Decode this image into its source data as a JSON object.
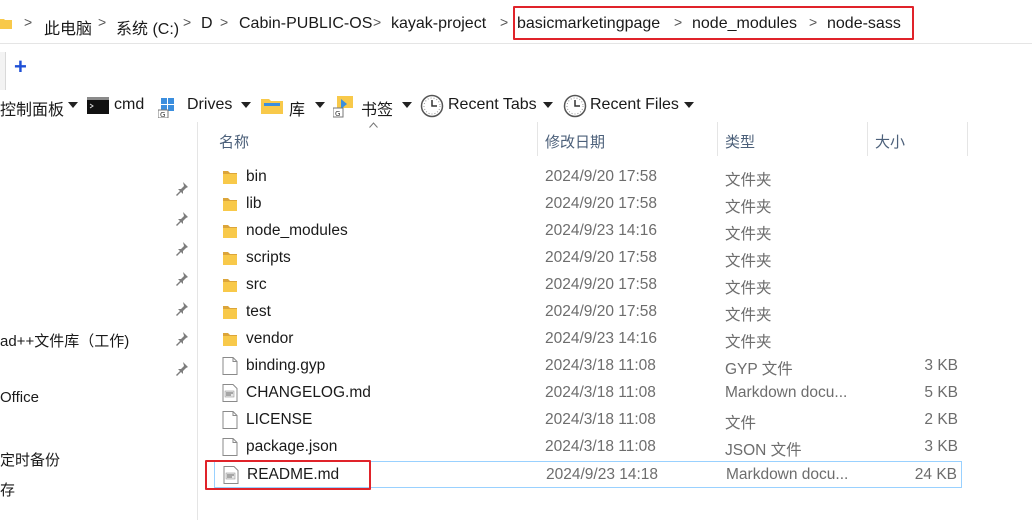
{
  "breadcrumb": {
    "items": [
      "此电脑",
      "系统 (C:)",
      "D",
      "Cabin-PUBLIC-OS",
      "kayak-project",
      "basicmarketingpage",
      "node_modules",
      "node-sass"
    ],
    "separator": ">"
  },
  "tabs": {
    "new_tab": "+"
  },
  "bookmarks": {
    "control_panel": "控制面板",
    "cmd": "cmd",
    "drives": "Drives",
    "library": "库",
    "bookmarks": "书签",
    "recent_tabs": "Recent Tabs",
    "recent_files": "Recent Files"
  },
  "nav": {
    "items": [
      "ad++文件库（工作)",
      "Office",
      "定时备份",
      "存"
    ]
  },
  "columns": {
    "name": "名称",
    "date": "修改日期",
    "type": "类型",
    "size": "大小"
  },
  "files": [
    {
      "name": "bin",
      "date": "2024/9/20 17:58",
      "type": "文件夹",
      "size": "",
      "icon": "folder-icon"
    },
    {
      "name": "lib",
      "date": "2024/9/20 17:58",
      "type": "文件夹",
      "size": "",
      "icon": "folder-icon"
    },
    {
      "name": "node_modules",
      "date": "2024/9/23 14:16",
      "type": "文件夹",
      "size": "",
      "icon": "folder-icon"
    },
    {
      "name": "scripts",
      "date": "2024/9/20 17:58",
      "type": "文件夹",
      "size": "",
      "icon": "folder-icon"
    },
    {
      "name": "src",
      "date": "2024/9/20 17:58",
      "type": "文件夹",
      "size": "",
      "icon": "folder-icon"
    },
    {
      "name": "test",
      "date": "2024/9/20 17:58",
      "type": "文件夹",
      "size": "",
      "icon": "folder-icon"
    },
    {
      "name": "vendor",
      "date": "2024/9/23 14:16",
      "type": "文件夹",
      "size": "",
      "icon": "folder-icon"
    },
    {
      "name": "binding.gyp",
      "date": "2024/3/18 11:08",
      "type": "GYP 文件",
      "size": "3 KB",
      "icon": "file-icon"
    },
    {
      "name": "CHANGELOG.md",
      "date": "2024/3/18 11:08",
      "type": "Markdown docu...",
      "size": "5 KB",
      "icon": "markdown-file-icon"
    },
    {
      "name": "LICENSE",
      "date": "2024/3/18 11:08",
      "type": "文件",
      "size": "2 KB",
      "icon": "file-icon"
    },
    {
      "name": "package.json",
      "date": "2024/3/18 11:08",
      "type": "JSON 文件",
      "size": "3 KB",
      "icon": "file-icon"
    },
    {
      "name": "README.md",
      "date": "2024/9/23 14:18",
      "type": "Markdown docu...",
      "size": "24 KB",
      "icon": "markdown-file-icon"
    }
  ],
  "colors": {
    "highlight": "#e0232a",
    "folder": "#f8c94a",
    "selection_border": "#99d1ff",
    "accent": "#1e4fd6"
  }
}
